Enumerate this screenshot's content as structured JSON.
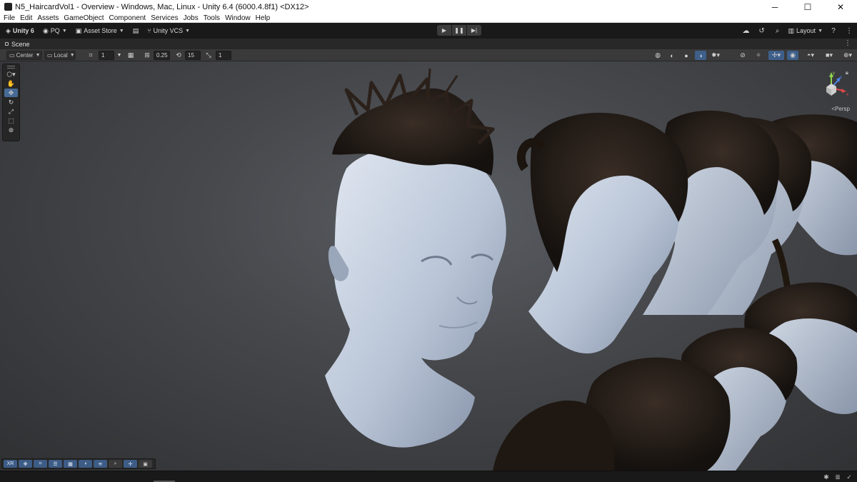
{
  "window": {
    "title": "N5_HaircardVol1 - Overview - Windows, Mac, Linux - Unity 6.4 (6000.4.8f1) <DX12>",
    "minimize": "─",
    "maximize": "☐",
    "close": "✕"
  },
  "menu": [
    "File",
    "Edit",
    "Assets",
    "GameObject",
    "Component",
    "Services",
    "Jobs",
    "Tools",
    "Window",
    "Help"
  ],
  "main_toolbar": {
    "unity_label": "Unity 6",
    "account_label": "PQ",
    "asset_store_label": "Asset Store",
    "vcs_label": "Unity VCS",
    "layout_label": "Layout"
  },
  "scene_tab": {
    "label": "Scene"
  },
  "scene_toolbar": {
    "pivot_label": "Center",
    "space_label": "Local",
    "grid_snap_value": "1",
    "increment_value": "0.25",
    "rotate_snap_value": "15",
    "scale_snap_value": "1"
  },
  "viewport": {
    "projection_label": "<Persp",
    "gizmo_axes": {
      "x": "x",
      "y": "y",
      "z": "z"
    }
  },
  "bottom_overlay": {
    "xr_label": "XR"
  },
  "icons": {
    "unity": "unity-logo-icon",
    "account": "account-icon",
    "cloud": "cloud-icon",
    "history": "history-icon",
    "search": "search-icon",
    "help": "help-icon"
  },
  "colors": {
    "accent": "#466a95",
    "toolbar": "#191919",
    "viewport": "#46484c",
    "skin": "#c4d0e0"
  }
}
